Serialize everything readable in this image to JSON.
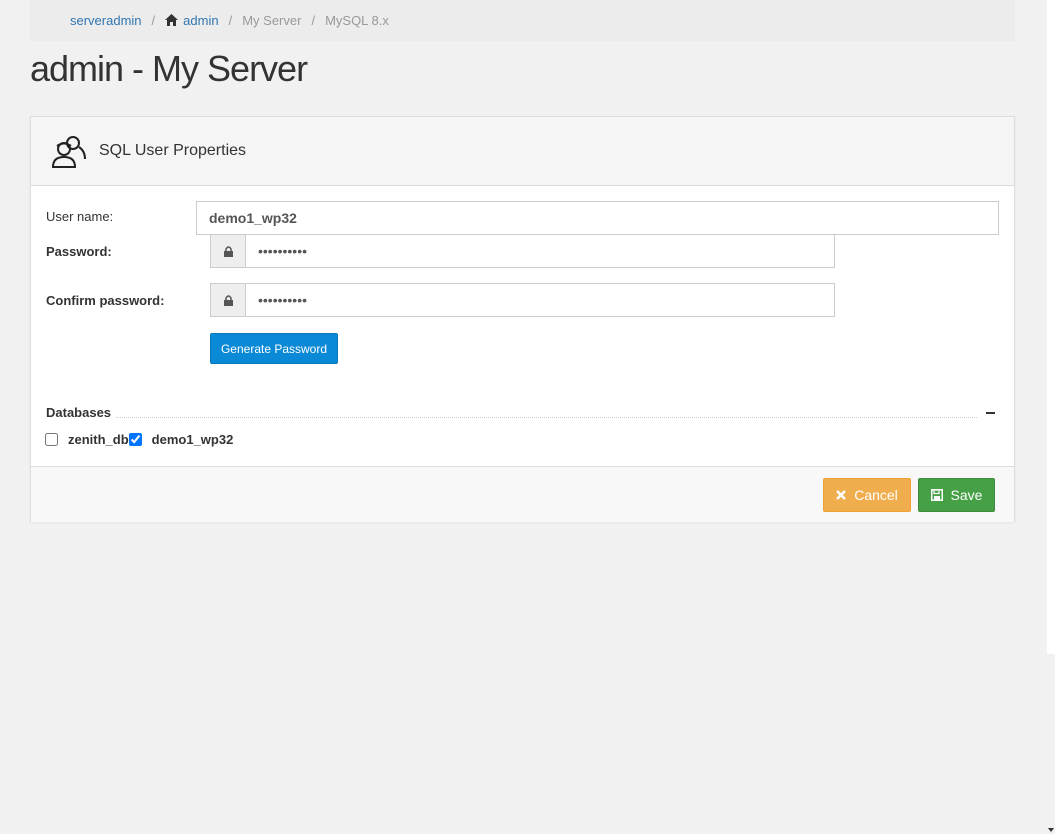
{
  "breadcrumb": {
    "items": [
      {
        "label": "serveradmin",
        "link": true
      },
      {
        "label": "admin",
        "link": true,
        "icon": "home-icon"
      },
      {
        "label": "My Server",
        "link": false
      },
      {
        "label": "MySQL 8.x",
        "link": false
      }
    ],
    "separator": "/"
  },
  "page": {
    "title": "admin - My Server"
  },
  "panel": {
    "title": "SQL User Properties",
    "icon": "users-icon",
    "form": {
      "username_label": "User name:",
      "username_value": "demo1_wp32",
      "password_label": "Password:",
      "password_value": "••••••••••",
      "confirm_label": "Confirm password:",
      "confirm_value": "••••••••••",
      "generate_label": "Generate Password"
    },
    "databases": {
      "legend": "Databases",
      "items": [
        {
          "label": "zenith_db",
          "checked": false
        },
        {
          "label": "demo1_wp32",
          "checked": true
        }
      ]
    },
    "footer": {
      "cancel_label": "Cancel",
      "save_label": "Save"
    }
  },
  "colors": {
    "link": "#3276b1",
    "primary": "#0a8ad6",
    "warning": "#f0ad4e",
    "success": "#46a046"
  }
}
